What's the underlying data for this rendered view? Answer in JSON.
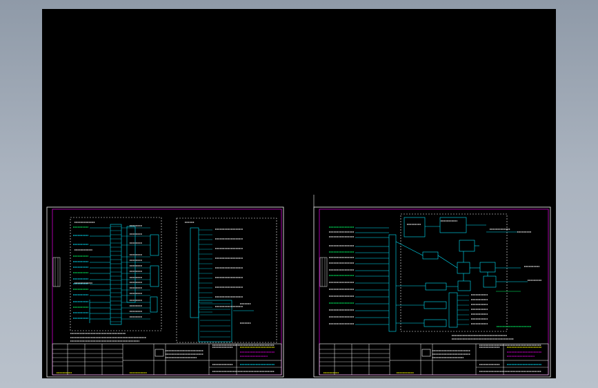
{
  "workspace": {
    "background": "#000000",
    "sheets": [
      {
        "id": "sheet-1",
        "accent": "#d000d0",
        "wire_color": "#00e6ff",
        "text_color": "#ffffff",
        "title_color": "#ffff00"
      },
      {
        "id": "sheet-2",
        "accent": "#d000d0",
        "wire_color": "#00e6ff",
        "text_color": "#ffffff",
        "title_color": "#ffff00"
      }
    ]
  }
}
